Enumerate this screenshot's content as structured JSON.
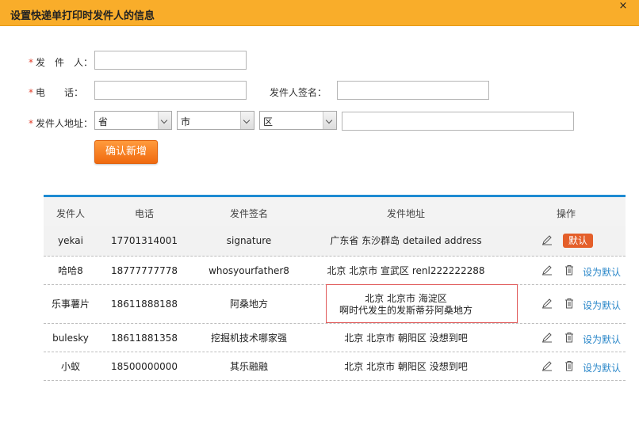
{
  "dialog": {
    "title": "设置快递单打印时发件人的信息",
    "close_glyph": "×"
  },
  "form": {
    "sender_label": "发　件　人：",
    "phone_label": "电　　话：",
    "signature_label": "发件人签名：",
    "address_label": "发件人地址：",
    "required_mark": "*",
    "sender_value": "",
    "phone_value": "",
    "signature_value": "",
    "province": "省",
    "city": "市",
    "district": "区",
    "detail_address": "",
    "confirm_label": "确认新增"
  },
  "table": {
    "headers": [
      "发件人",
      "电话",
      "发件签名",
      "发件地址",
      "操作"
    ],
    "rows": [
      {
        "name": "yekai",
        "phone": "17701314001",
        "signature": "signature",
        "address_line1": "广东省 东沙群岛 detailed address",
        "address_line2": "",
        "action": "默认",
        "is_default": true
      },
      {
        "name": "哈哈8",
        "phone": "18777777778",
        "signature": "whosyourfather8",
        "address_line1": "北京 北京市 宣武区 renl222222288",
        "address_line2": "",
        "action": "设为默认",
        "is_default": false
      },
      {
        "name": "乐事薯片",
        "phone": "18611888188",
        "signature": "阿桑地方",
        "address_line1": "北京 北京市 海淀区",
        "address_line2": "啊时代发生的发斯蒂芬阿桑地方",
        "action": "设为默认",
        "is_default": false
      },
      {
        "name": "bulesky",
        "phone": "18611881358",
        "signature": "挖掘机技术哪家强",
        "address_line1": "北京 北京市 朝阳区 没想到吧",
        "address_line2": "",
        "action": "设为默认",
        "is_default": false
      },
      {
        "name": "小蚁",
        "phone": "18500000000",
        "signature": "其乐融融",
        "address_line1": "北京 北京市 朝阳区 没想到吧",
        "address_line2": "",
        "action": "设为默认",
        "is_default": false
      }
    ]
  },
  "colors": {
    "title_bar": "#f9ad2a",
    "accent_orange": "#f06a0f",
    "table_accent": "#1e8bd2",
    "default_badge": "#e45f2a",
    "link_blue": "#2a87c9",
    "highlight_border": "#e05a5a"
  },
  "icons": {
    "edit": "pencil-icon",
    "delete": "trash-icon",
    "close": "close-icon",
    "dropdown": "chevron-down-icon"
  }
}
